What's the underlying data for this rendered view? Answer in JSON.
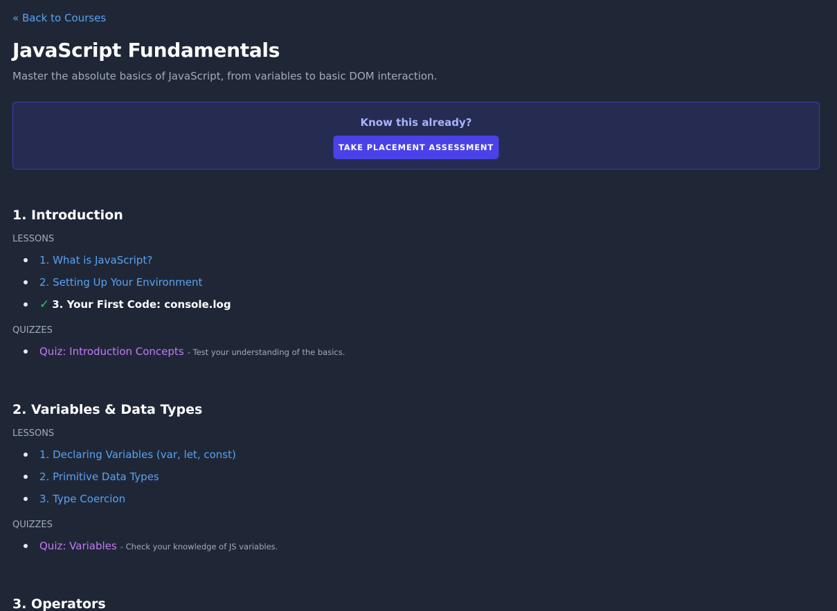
{
  "nav": {
    "back_label": "« Back to Courses"
  },
  "course": {
    "title": "JavaScript Fundamentals",
    "description": "Master the absolute basics of JavaScript, from variables to basic DOM interaction."
  },
  "placement": {
    "question": "Know this already?",
    "button_label": "TAKE PLACEMENT ASSESSMENT"
  },
  "labels": {
    "lessons": "LESSONS",
    "quizzes": "QUIZZES"
  },
  "icons": {
    "completed": "check-icon",
    "completed_color": "#2fc76a"
  },
  "colors": {
    "background": "#1f2737",
    "link": "#5aa2f0",
    "quiz_link": "#c27cf5",
    "button": "#4a42e8"
  },
  "sections": [
    {
      "title": "1. Introduction",
      "lessons": [
        {
          "label": "1. What is JavaScript?",
          "completed": false
        },
        {
          "label": "2. Setting Up Your Environment",
          "completed": false
        },
        {
          "label": "3. Your First Code: console.log",
          "completed": true
        }
      ],
      "quizzes": [
        {
          "label": "Quiz: Introduction Concepts",
          "description": "- Test your understanding of the basics."
        }
      ]
    },
    {
      "title": "2. Variables & Data Types",
      "lessons": [
        {
          "label": "1. Declaring Variables (var, let, const)",
          "completed": false
        },
        {
          "label": "2. Primitive Data Types",
          "completed": false
        },
        {
          "label": "3. Type Coercion",
          "completed": false
        }
      ],
      "quizzes": [
        {
          "label": "Quiz: Variables",
          "description": "- Check your knowledge of JS variables."
        }
      ]
    },
    {
      "title": "3. Operators"
    }
  ]
}
